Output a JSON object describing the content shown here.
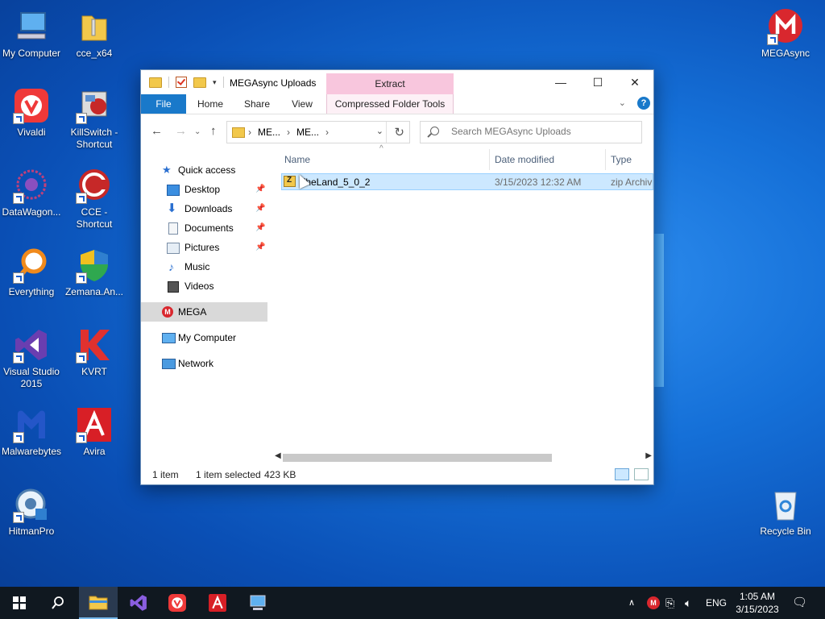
{
  "desktop": {
    "icons": [
      {
        "label": "My Computer"
      },
      {
        "label": "cce_x64"
      },
      {
        "label": "Vivaldi"
      },
      {
        "label": "KillSwitch - Shortcut"
      },
      {
        "label": "DataWagon..."
      },
      {
        "label": "CCE - Shortcut"
      },
      {
        "label": "Everything"
      },
      {
        "label": "Zemana.An..."
      },
      {
        "label": "Visual Studio 2015"
      },
      {
        "label": "KVRT"
      },
      {
        "label": "Malwarebytes"
      },
      {
        "label": "Avira"
      },
      {
        "label": "HitmanPro"
      },
      {
        "label": "MEGAsync"
      },
      {
        "label": "Recycle Bin"
      }
    ]
  },
  "window": {
    "title": "MEGAsync Uploads",
    "context_tab": "Extract",
    "ribbon_tabs": [
      "File",
      "Home",
      "Share",
      "View",
      "Compressed Folder Tools"
    ],
    "address_segments": [
      "ME...",
      "ME..."
    ],
    "search_placeholder": "Search MEGAsync Uploads",
    "nav_items": [
      {
        "label": "Quick access"
      },
      {
        "label": "Desktop"
      },
      {
        "label": "Downloads"
      },
      {
        "label": "Documents"
      },
      {
        "label": "Pictures"
      },
      {
        "label": "Music"
      },
      {
        "label": "Videos"
      },
      {
        "label": "MEGA"
      },
      {
        "label": "My Computer"
      },
      {
        "label": "Network"
      }
    ],
    "columns": [
      "Name",
      "Date modified",
      "Type"
    ],
    "files": [
      {
        "name": "TheLand_5_0_2",
        "date": "3/15/2023 12:32 AM",
        "type": "zip Archiv"
      }
    ],
    "status": {
      "items": "1 item",
      "selected": "1 item selected",
      "size": "423 KB"
    }
  },
  "taskbar": {
    "lang": "ENG",
    "time": "1:05 AM",
    "date": "3/15/2023"
  },
  "colors": {
    "file_tab": "#1979ca",
    "context_tab": "#f8c6dd",
    "selection": "#cce8ff",
    "taskbar": "#101820"
  }
}
